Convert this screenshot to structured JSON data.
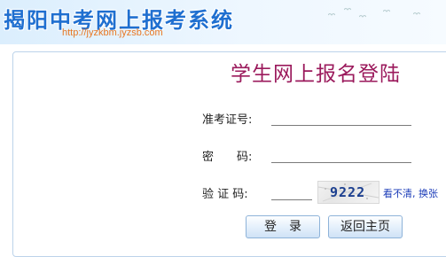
{
  "header": {
    "site_title": "揭阳中考网上报考系统",
    "site_url": "http://jyzkbm.jyzsb.com"
  },
  "login": {
    "title": "学生网上报名登陆",
    "exam_id_label": "准考证号:",
    "password_label": "密　　码:",
    "captcha_label": "验 证 码:",
    "exam_id_value": "",
    "password_value": "",
    "captcha_value": "",
    "captcha_code": "9222",
    "refresh_link": "看不清, 换张",
    "login_button": "登　录",
    "home_button": "返回主页"
  }
}
